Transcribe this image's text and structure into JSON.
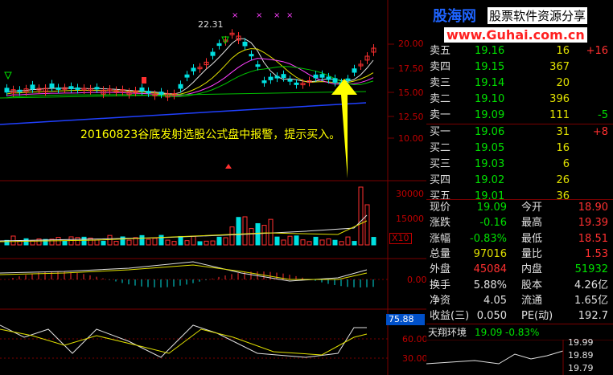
{
  "watermark": {
    "site_cn": "股海网",
    "slogan": "股票软件资源分享",
    "url": "www.Guhai.com.cn"
  },
  "chart": {
    "high_label": "22.31",
    "annotation": "20160823谷底发射选股公式盘中报警，提示买入。",
    "price_axis": [
      "20.00",
      "17.50",
      "15.00",
      "12.50",
      "10.00"
    ],
    "volume_axis": [
      "30000",
      "15000"
    ],
    "volume_unit": "X10",
    "macd_axis": [
      "0.00"
    ],
    "kdj_axis": [
      "60.00",
      "30.00"
    ],
    "kdj_value_box": "75.88"
  },
  "orderbook": {
    "sell": [
      {
        "label": "卖五",
        "price": "19.16",
        "volume": "16",
        "change": "+16"
      },
      {
        "label": "卖四",
        "price": "19.15",
        "volume": "367",
        "change": ""
      },
      {
        "label": "卖三",
        "price": "19.14",
        "volume": "20",
        "change": ""
      },
      {
        "label": "卖二",
        "price": "19.10",
        "volume": "396",
        "change": ""
      },
      {
        "label": "卖一",
        "price": "19.09",
        "volume": "111",
        "change": "-5"
      }
    ],
    "buy": [
      {
        "label": "买一",
        "price": "19.06",
        "volume": "31",
        "change": "+8"
      },
      {
        "label": "买二",
        "price": "19.05",
        "volume": "16",
        "change": ""
      },
      {
        "label": "买三",
        "price": "19.03",
        "volume": "6",
        "change": ""
      },
      {
        "label": "买四",
        "price": "19.02",
        "volume": "26",
        "change": ""
      },
      {
        "label": "买五",
        "price": "19.01",
        "volume": "36",
        "change": ""
      }
    ]
  },
  "stats": [
    {
      "l1": "现价",
      "v1": "19.09",
      "l2": "今开",
      "v2": "18.90"
    },
    {
      "l1": "涨跌",
      "v1": "-0.16",
      "l2": "最高",
      "v2": "19.39"
    },
    {
      "l1": "涨幅",
      "v1": "-0.83%",
      "l2": "最低",
      "v2": "18.51"
    },
    {
      "l1": "总量",
      "v1": "97016",
      "l2": "量比",
      "v2": "1.53"
    },
    {
      "l1": "外盘",
      "v1": "45084",
      "l2": "内盘",
      "v2": "51932"
    },
    {
      "l1": "换手",
      "v1": "5.88%",
      "l2": "股本",
      "v2": "4.26亿"
    },
    {
      "l1": "净资",
      "v1": "4.05",
      "l2": "流通",
      "v2": "1.65亿"
    },
    {
      "l1": "收益(三)",
      "v1": "0.050",
      "l2": "PE(动)",
      "v2": "192.7"
    }
  ],
  "ticker": {
    "name": "天翔环境",
    "price": "19.09",
    "change": "-0.83%",
    "mini_axis": [
      "19.99",
      "19.89",
      "19.79"
    ]
  },
  "colors": {
    "up": "#ff3030",
    "down": "#00e000",
    "axis": "#c00000",
    "label": "#e0e0e0",
    "volume": "#e0e000",
    "annotation": "#ffff00"
  }
}
